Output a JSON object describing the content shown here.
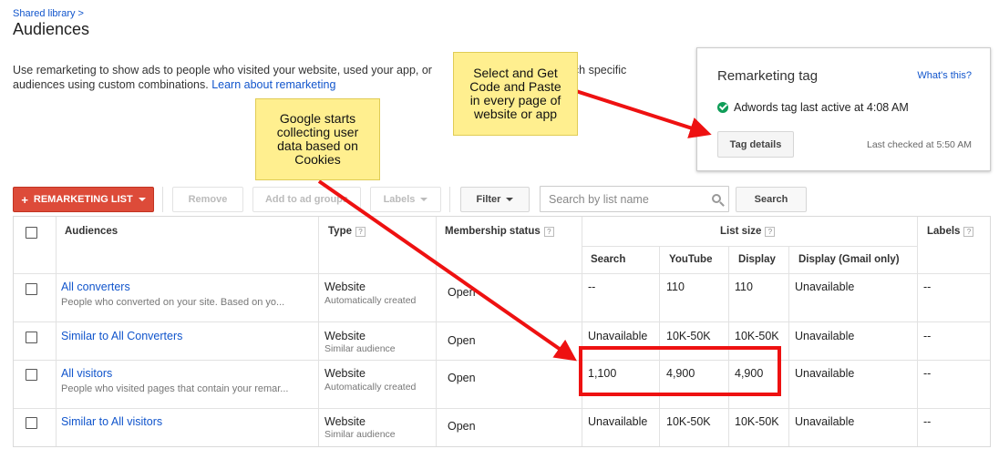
{
  "breadcrumb": "Shared library >",
  "page_title": "Audiences",
  "intro": {
    "line1": "Use remarketing to show ads to people who visited your website, used your app, or",
    "line1_tail": "ach specific",
    "line2": "audiences using custom combinations.",
    "learn_link": "Learn about remarketing"
  },
  "tag_card": {
    "title": "Remarketing tag",
    "whats_this": "What's this?",
    "status": "Adwords tag last active at 4:08 AM",
    "tag_details_button": "Tag details",
    "last_checked": "Last checked at 5:50 AM"
  },
  "toolbar": {
    "remarketing_list": "REMARKETING LIST",
    "remove": "Remove",
    "add_to_ad_groups": "Add to ad groups",
    "labels": "Labels",
    "filter": "Filter",
    "search_placeholder": "Search by list name",
    "search_button": "Search"
  },
  "table": {
    "headers": {
      "audiences": "Audiences",
      "type": "Type",
      "membership": "Membership status",
      "list_size": "List size",
      "search": "Search",
      "youtube": "YouTube",
      "display": "Display",
      "gmail": "Display (Gmail only)",
      "labels": "Labels",
      "help": "?"
    },
    "rows": [
      {
        "name": "All converters",
        "desc": "People who converted on your site. Based on yo...",
        "type": "Website",
        "type_sub": "Automatically created",
        "membership": "Open",
        "search": "--",
        "youtube": "110",
        "display": "110",
        "gmail": "Unavailable",
        "labels": "--"
      },
      {
        "name": "Similar to All Converters",
        "desc": "",
        "type": "Website",
        "type_sub": "Similar audience",
        "membership": "Open",
        "search": "Unavailable",
        "youtube": "10K-50K",
        "display": "10K-50K",
        "gmail": "Unavailable",
        "labels": "--"
      },
      {
        "name": "All visitors",
        "desc": "People who visited pages that contain your remar...",
        "type": "Website",
        "type_sub": "Automatically created",
        "membership": "Open",
        "search": "1,100",
        "youtube": "4,900",
        "display": "4,900",
        "gmail": "Unavailable",
        "labels": "--"
      },
      {
        "name": "Similar to All visitors",
        "desc": "",
        "type": "Website",
        "type_sub": "Similar audience",
        "membership": "Open",
        "search": "Unavailable",
        "youtube": "10K-50K",
        "display": "10K-50K",
        "gmail": "Unavailable",
        "labels": "--"
      }
    ]
  },
  "annotations": {
    "note_tag": [
      "Select and Get",
      "Code and Paste",
      "in every page of",
      "website or app"
    ],
    "note_cookies": [
      "Google starts",
      "collecting user",
      "data based on",
      "Cookies"
    ]
  },
  "colors": {
    "link": "#1155cc",
    "red_button": "#dd4b39",
    "annotation_red": "#ee1111",
    "note_yellow": "#ffef8f",
    "status_green": "#0f9d58"
  }
}
